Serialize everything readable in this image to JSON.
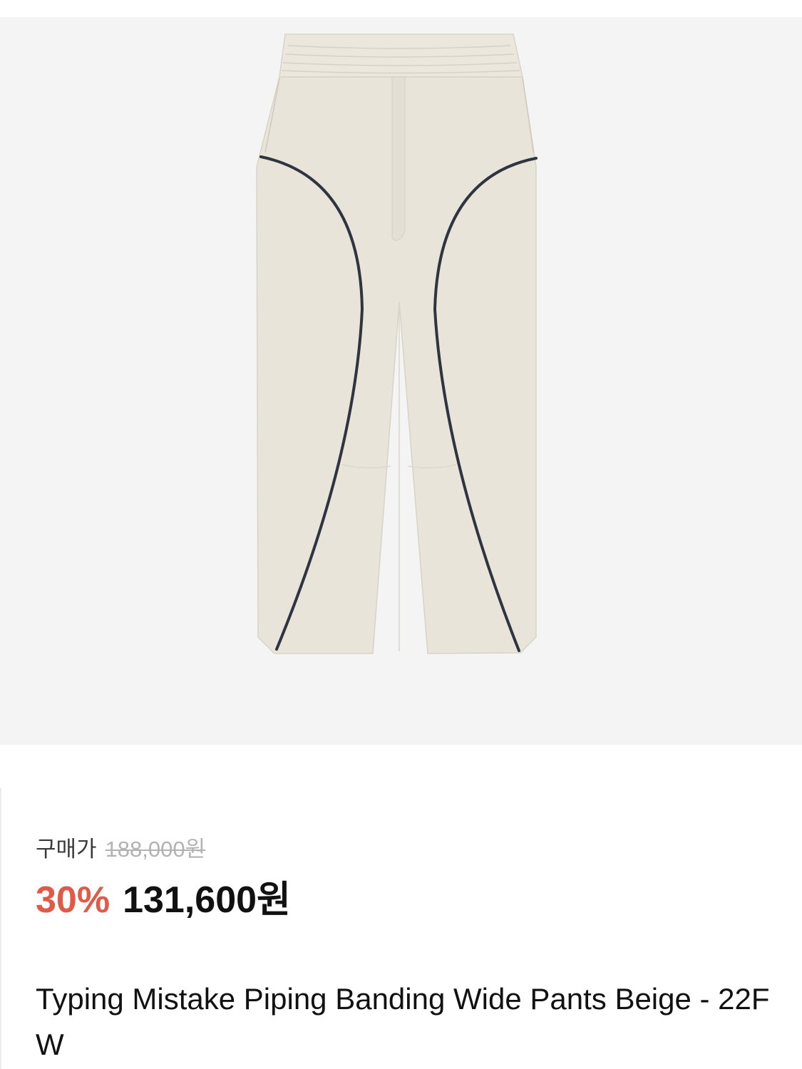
{
  "product": {
    "image_icon": "beige-wide-pants-photo",
    "colors": {
      "image_bg": "#f4f4f4",
      "fabric": "#e8e4da",
      "piping": "#2e3440",
      "discount": "#e05a47"
    }
  },
  "pricing": {
    "original_label": "구매가",
    "original_price": "188,000원",
    "discount_rate": "30%",
    "sale_price": "131,600원"
  },
  "title": "Typing Mistake Piping Banding Wide Pants Beige - 22FW"
}
